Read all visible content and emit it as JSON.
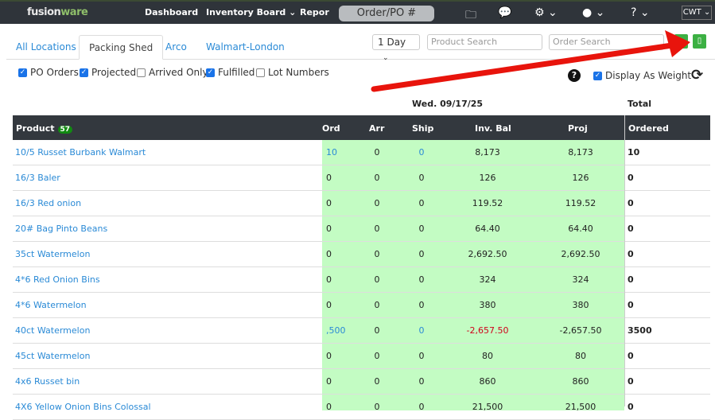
{
  "nav": {
    "logo_a": "fusion",
    "logo_b": "ware",
    "dashboard": "Dashboard",
    "inventory_board": "Inventory Board",
    "reports": "Repor",
    "order_po": "Order/PO #",
    "unit": "CWT ⌄"
  },
  "tabs": [
    "All Locations",
    "Packing Shed",
    "Arco",
    "Walmart-London"
  ],
  "filters": {
    "range": "1 Day",
    "product_placeholder": "Product Search",
    "order_placeholder": "Order Search"
  },
  "checkboxes": [
    {
      "label": "PO Orders",
      "checked": true
    },
    {
      "label": "Projected",
      "checked": true
    },
    {
      "label": "Arrived Only",
      "checked": false
    },
    {
      "label": "Fulfilled",
      "checked": true
    },
    {
      "label": "Lot Numbers",
      "checked": false
    }
  ],
  "display_as_weight": {
    "label": "Display As Weight",
    "checked": true
  },
  "date_header": "Wed. 09/17/25",
  "total_header": "Total",
  "columns": {
    "product": "Product",
    "count": "57",
    "ord": "Ord",
    "arr": "Arr",
    "ship": "Ship",
    "inv": "Inv. Bal",
    "proj": "Proj",
    "ordered": "Ordered"
  },
  "rows": [
    {
      "product": "10/5 Russet Burbank Walmart",
      "ord": "10",
      "arr": "0",
      "ship": "0",
      "inv": "8,173",
      "proj": "8,173",
      "ordered": "10"
    },
    {
      "product": "16/3 Baler",
      "ord": "0",
      "arr": "0",
      "ship": "0",
      "inv": "126",
      "proj": "126",
      "ordered": "0"
    },
    {
      "product": "16/3 Red onion",
      "ord": "0",
      "arr": "0",
      "ship": "0",
      "inv": "119.52",
      "proj": "119.52",
      "ordered": "0"
    },
    {
      "product": "20# Bag Pinto Beans",
      "ord": "0",
      "arr": "0",
      "ship": "0",
      "inv": "64.40",
      "proj": "64.40",
      "ordered": "0"
    },
    {
      "product": "35ct Watermelon",
      "ord": "0",
      "arr": "0",
      "ship": "0",
      "inv": "2,692.50",
      "proj": "2,692.50",
      "ordered": "0"
    },
    {
      "product": "4*6 Red Onion Bins",
      "ord": "0",
      "arr": "0",
      "ship": "0",
      "inv": "324",
      "proj": "324",
      "ordered": "0"
    },
    {
      "product": "4*6 Watermelon",
      "ord": "0",
      "arr": "0",
      "ship": "0",
      "inv": "380",
      "proj": "380",
      "ordered": "0"
    },
    {
      "product": "40ct Watermelon",
      "ord": ",500",
      "arr": "0",
      "ship": "0",
      "inv": "-2,657.50",
      "proj": "-2,657.50",
      "ordered": "3500"
    },
    {
      "product": "45ct Watermelon",
      "ord": "0",
      "arr": "0",
      "ship": "0",
      "inv": "80",
      "proj": "80",
      "ordered": "0"
    },
    {
      "product": "4x6 Russet bin",
      "ord": "0",
      "arr": "0",
      "ship": "0",
      "inv": "860",
      "proj": "860",
      "ordered": "0"
    },
    {
      "product": "4X6 Yellow Onion Bins Colossal",
      "ord": "0",
      "arr": "0",
      "ship": "0",
      "inv": "21,500",
      "proj": "21,500",
      "ordered": "0"
    }
  ],
  "colors": {
    "nav": "#2f343a",
    "link": "#2a8ad6",
    "green_col": "#c3fcc3",
    "negative": "#d0021b",
    "annotation": "#e8140c"
  }
}
